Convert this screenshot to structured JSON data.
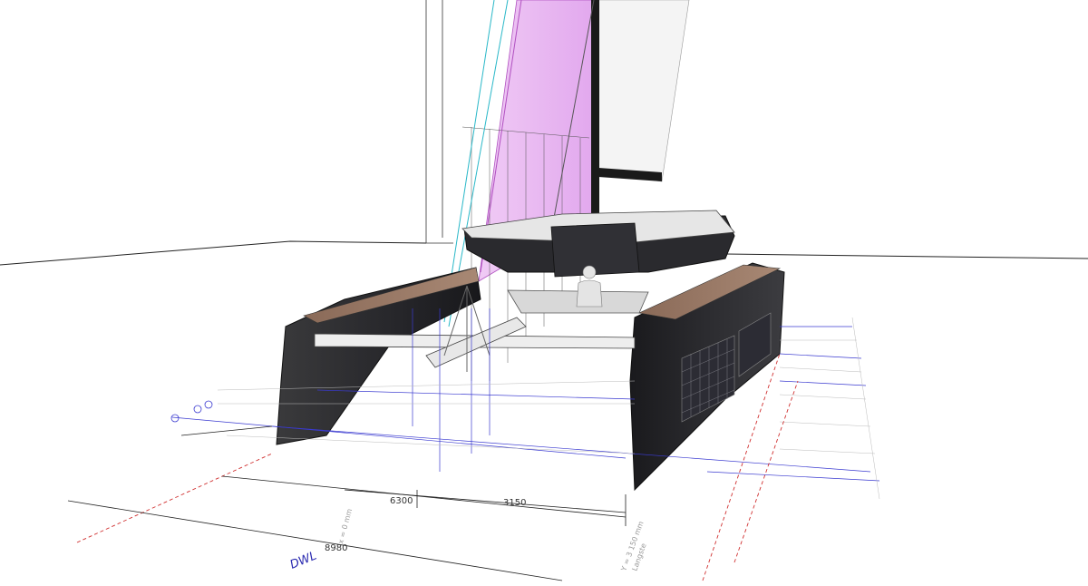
{
  "dimensions": {
    "beam_left": "6300",
    "beam_right": "3150",
    "overall": "8980",
    "waterline": "DWL",
    "side_note": "Y = 3 150 mm",
    "side_note_2": "Langste",
    "centre_note": "x = 0 mm"
  },
  "colors": {
    "hull": "#2b2b2d",
    "deck_wood": "#9a7a66",
    "sail_magenta": "#e8b8f0",
    "rig_cyan": "#2ab8c8",
    "grid_blue": "#3a3ad0",
    "dim_red": "#d03030"
  }
}
